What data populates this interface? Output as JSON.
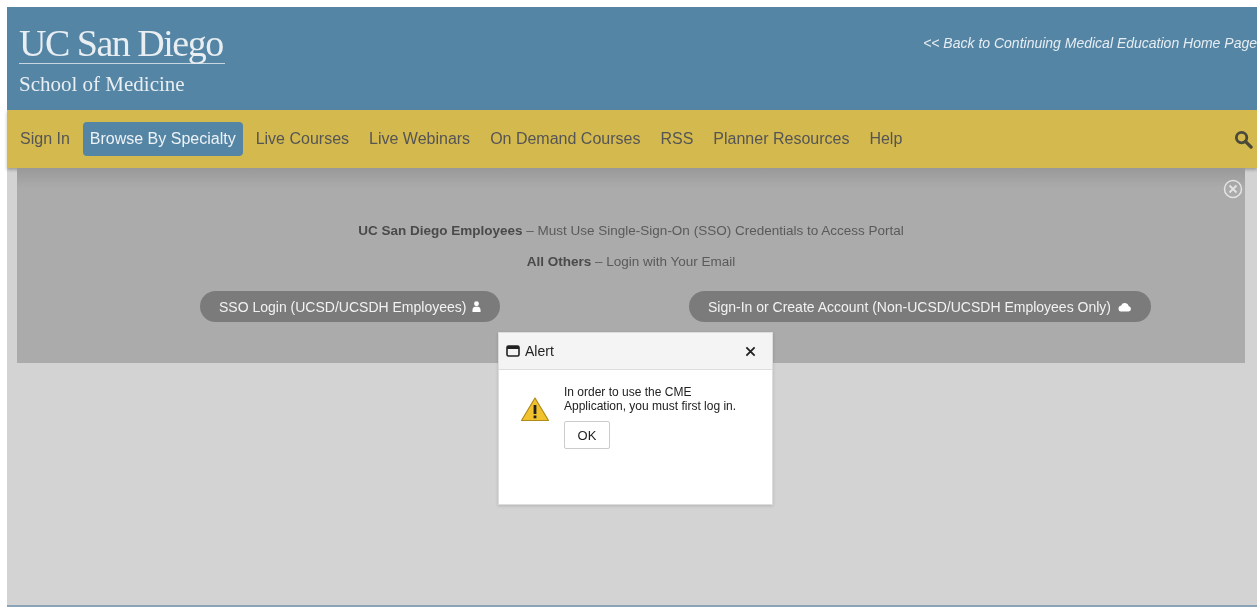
{
  "header": {
    "logo_title": "UC San Diego",
    "logo_subtitle": "School of Medicine",
    "back_link": "<< Back to Continuing Medical Education Home Page"
  },
  "nav": {
    "items": [
      {
        "label": "Sign In",
        "selected": false
      },
      {
        "label": "Browse By Specialty",
        "selected": true
      },
      {
        "label": "Live Courses",
        "selected": false
      },
      {
        "label": "Live Webinars",
        "selected": false
      },
      {
        "label": "On Demand Courses",
        "selected": false
      },
      {
        "label": "RSS",
        "selected": false
      },
      {
        "label": "Planner Resources",
        "selected": false
      },
      {
        "label": "Help",
        "selected": false
      }
    ]
  },
  "notice": {
    "lines": [
      "**UC San Diego Employees** – Must Use Single-Sign-On (SSO) Credentials to Access Portal",
      "**All Others** – Login with Your Email"
    ],
    "buttons": [
      {
        "label": "SSO Login (UCSD/UCSDH Employees)",
        "kind": "user"
      },
      {
        "label": "Sign-In or Create Account (Non-UCSD/UCSDH Employees Only)",
        "kind": "cloud"
      }
    ]
  },
  "dialog": {
    "title": "Alert",
    "message": "In order to use the CME Application, you must first log in.",
    "button": "OK"
  }
}
